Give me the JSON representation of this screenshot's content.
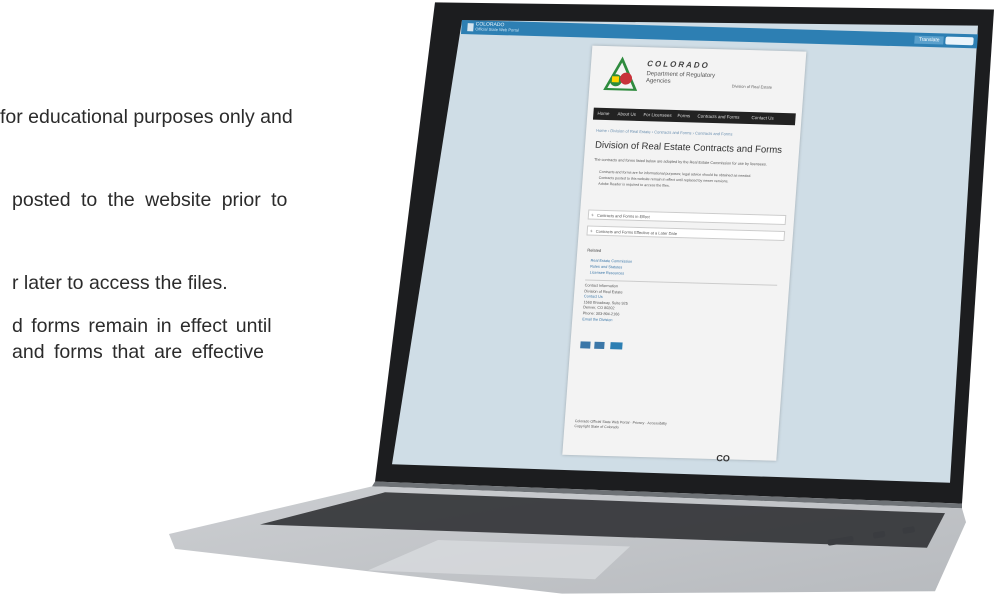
{
  "background_text": {
    "line1": "for educational purposes only and",
    "line2": "posted to the website prior to",
    "line3": "r later to access the files.",
    "line4": "d forms remain in effect until",
    "line5": "and forms that are effective"
  },
  "colors": {
    "screen_bg": "#cfdde6",
    "topbar": "#2d7fb3",
    "navbar": "#222222",
    "link": "#3b77a8"
  },
  "screen": {
    "topbar": {
      "title": "COLORADO",
      "subtitle": "Official State Web Portal",
      "button": "Translate",
      "search_icon": "search-icon"
    },
    "site": {
      "logo_wordmark": "COLORADO",
      "logo_dept": "Department of Regulatory Agencies",
      "logo_division": "Division of Real Estate",
      "nav": [
        "Home",
        "About Us",
        "For Licensees",
        "Forms",
        "Contracts and Forms",
        "Contact Us"
      ],
      "breadcrumbs": "Home › Division of Real Estate › Contracts and Forms › Contracts and Forms",
      "heading": "Division of Real Estate Contracts and Forms",
      "intro": "The contracts and forms listed below are adopted by the Real Estate Commission for use by licensees.",
      "bullets": [
        "Contracts and forms are for informational purposes; legal advice should be obtained as needed.",
        "Contracts posted to this website remain in effect until replaced by newer versions.",
        "Adobe Reader is required to access the files."
      ],
      "expand_1": "Contracts and Forms in Effect",
      "expand_2": "Contracts and Forms Effective at a Later Date",
      "section_label": "Related",
      "links": [
        "Real Estate Commission",
        "Rules and Statutes",
        "Licensee Resources"
      ],
      "contact": {
        "heading": "Contact Information",
        "org": "Division of Real Estate",
        "link": "Contact Us",
        "address": "1560 Broadway, Suite 925",
        "city": "Denver, CO 80202",
        "phone": "Phone: 303-894-2166",
        "email_link": "Email the Division"
      },
      "social": [
        "facebook",
        "twitter"
      ],
      "footer": "Colorado Official State Web Portal · Privacy · Accessibility",
      "footer2": "Copyright State of Colorado",
      "footer_logo": "CO"
    }
  }
}
